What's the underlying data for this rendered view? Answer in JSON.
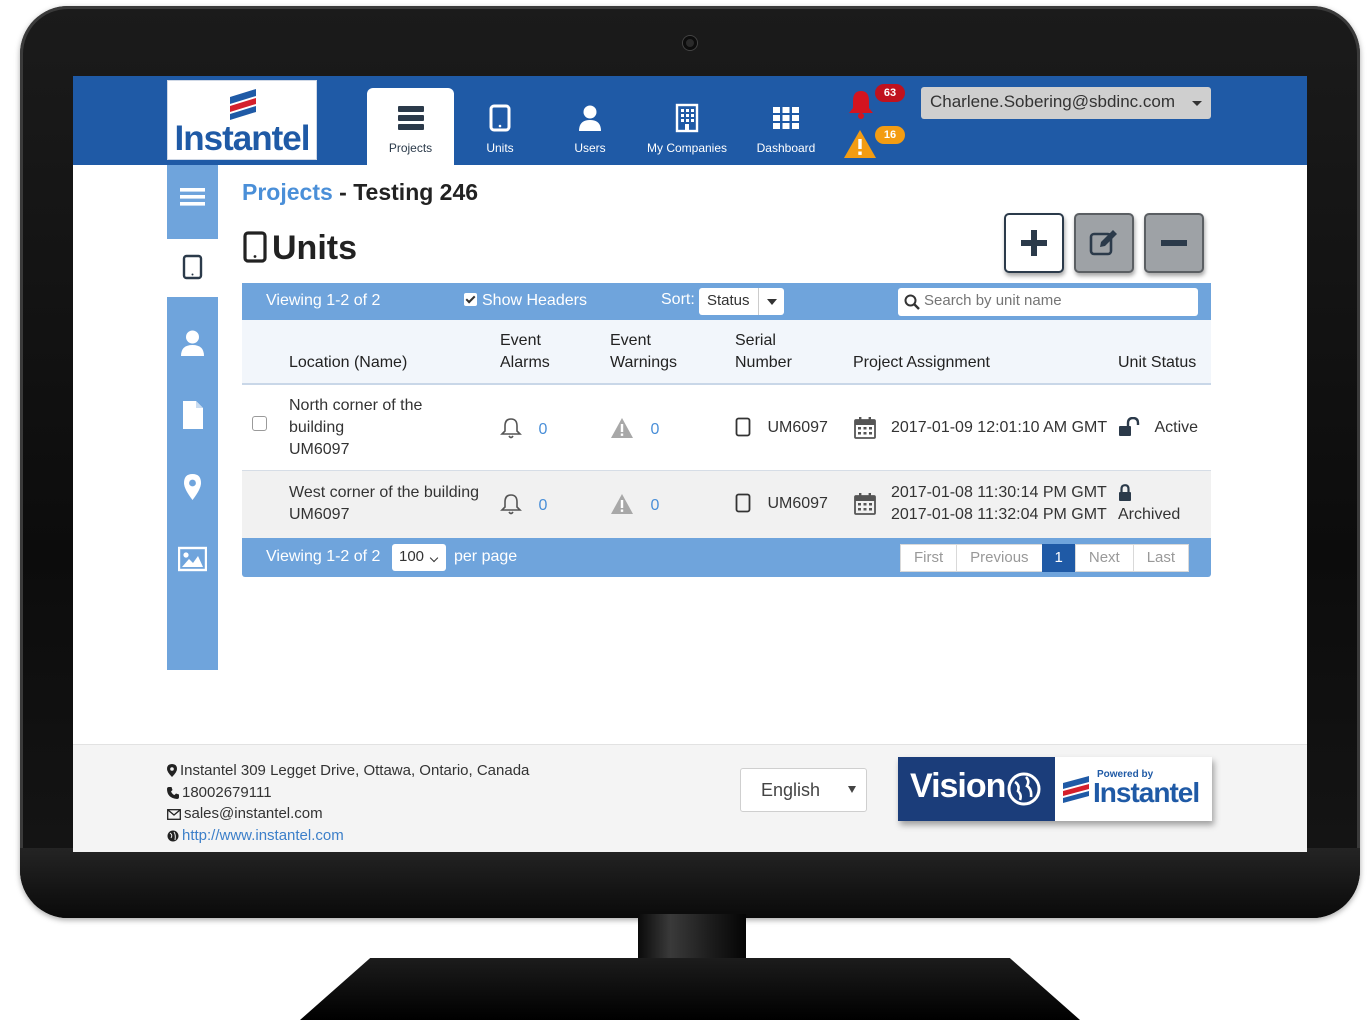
{
  "header": {
    "logo_text": "Instantel",
    "tabs": [
      {
        "label": "Projects",
        "icon": "server-stack-icon",
        "active": true
      },
      {
        "label": "Units",
        "icon": "tablet-icon"
      },
      {
        "label": "Users",
        "icon": "user-icon"
      },
      {
        "label": "My Companies",
        "icon": "building-icon"
      },
      {
        "label": "Dashboard",
        "icon": "grid-icon"
      }
    ],
    "alarm_count": "63",
    "warning_count": "16",
    "user_email": "Charlene.Sobering@sbdinc.com"
  },
  "colors": {
    "brand_blue": "#1f5aa6",
    "panel_blue": "#6fa4dc",
    "link_blue": "#4a8fd8",
    "alarm_red": "#c0121e",
    "warning_orange": "#f39c12"
  },
  "sidebar": {
    "items": [
      "menu-icon",
      "tablet-icon",
      "user-icon",
      "document-icon",
      "map-pin-icon",
      "image-icon"
    ]
  },
  "breadcrumb": {
    "parent": "Projects",
    "separator": " - ",
    "current": "Testing 246"
  },
  "page_title": "Units",
  "toolbar": {
    "viewing": "Viewing 1-2 of 2",
    "show_headers": "Show Headers",
    "sort_label": "Sort:",
    "sort_value": "Status",
    "search_placeholder": "Search by unit name"
  },
  "table": {
    "columns": {
      "location": "Location (Name)",
      "alarms_1": "Event",
      "alarms_2": "Alarms",
      "warnings_1": "Event",
      "warnings_2": "Warnings",
      "serial_1": "Serial",
      "serial_2": "Number",
      "assignment": "Project Assignment",
      "status": "Unit Status"
    },
    "rows": [
      {
        "location_line1": "North corner of the",
        "location_line2": "building",
        "location_line3": "UM6097",
        "alarms": "0",
        "warnings": "0",
        "serial": "UM6097",
        "assign_line1": "2017-01-09 12:01:10 AM GMT",
        "assign_line2": "",
        "status": "Active"
      },
      {
        "location_line1": "West corner of the building",
        "location_line2": "UM6097",
        "alarms": "0",
        "warnings": "0",
        "serial": "UM6097",
        "assign_line1": "2017-01-08 11:30:14 PM GMT",
        "assign_line2": "2017-01-08 11:32:04 PM GMT",
        "status": "Archived"
      }
    ]
  },
  "pagination": {
    "viewing": "Viewing 1-2 of 2",
    "per_page_value": "100",
    "per_page_label": "per page",
    "first": "First",
    "previous": "Previous",
    "current": "1",
    "next": "Next",
    "last": "Last"
  },
  "footer": {
    "address": "Instantel 309 Legget Drive, Ottawa, Ontario, Canada",
    "phone": "18002679111",
    "email": "sales@instantel.com",
    "website": "http://www.instantel.com",
    "language": "English",
    "vision_text": "Vision",
    "powered_by": "Powered by",
    "powered_brand": "Instantel"
  }
}
